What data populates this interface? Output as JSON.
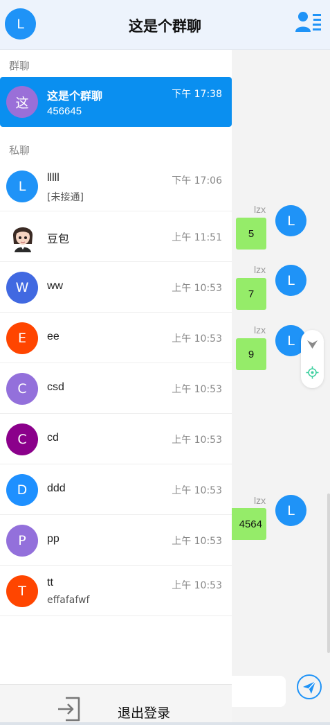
{
  "header": {
    "user_avatar_letter": "L",
    "title": "这是个群聊",
    "members_icon": "user-list-icon"
  },
  "drawer": {
    "group_section_label": "群聊",
    "group": {
      "avatar_letter": "这",
      "name": "这是个群聊",
      "time": "下午 17:38",
      "preview": "456645"
    },
    "private_section_label": "私聊",
    "contacts": [
      {
        "avatar_letter": "L",
        "avatar_color": "#1f93f7",
        "name": "lllll",
        "time": "下午 17:06",
        "preview": "[未接通]"
      },
      {
        "avatar_letter": "",
        "avatar_color": "#ffffff",
        "avatar_kind": "image",
        "name": "豆包",
        "time": "上午 11:51",
        "preview": ""
      },
      {
        "avatar_letter": "W",
        "avatar_color": "#4169e1",
        "name": "ww",
        "time": "上午 10:53",
        "preview": ""
      },
      {
        "avatar_letter": "E",
        "avatar_color": "#ff4500",
        "name": "ee",
        "time": "上午 10:53",
        "preview": ""
      },
      {
        "avatar_letter": "C",
        "avatar_color": "#9370db",
        "name": "csd",
        "time": "上午 10:53",
        "preview": ""
      },
      {
        "avatar_letter": "C",
        "avatar_color": "#8b008b",
        "name": "cd",
        "time": "上午 10:53",
        "preview": ""
      },
      {
        "avatar_letter": "D",
        "avatar_color": "#1e90ff",
        "name": "ddd",
        "time": "上午 10:53",
        "preview": ""
      },
      {
        "avatar_letter": "P",
        "avatar_color": "#9370db",
        "name": "pp",
        "time": "上午 10:53",
        "preview": ""
      },
      {
        "avatar_letter": "T",
        "avatar_color": "#ff4500",
        "name": "tt",
        "time": "上午 10:53",
        "preview": "effafafwf"
      }
    ],
    "logout_label": "退出登录",
    "logout_icon": "logout-icon"
  },
  "chat": {
    "messages": [
      {
        "sender": "lzx",
        "avatar_letter": "L",
        "text": "5"
      },
      {
        "sender": "lzx",
        "avatar_letter": "L",
        "text": "7"
      },
      {
        "sender": "lzx",
        "avatar_letter": "L",
        "text": "9"
      },
      {
        "sender": "lzx",
        "avatar_letter": "L",
        "text": "4564"
      }
    ],
    "send_icon": "send-icon"
  },
  "colors": {
    "accent": "#0a8ff0",
    "header_bg": "#edf3fc",
    "bubble": "#95ec69",
    "user_avatar": "#1f93f7"
  }
}
